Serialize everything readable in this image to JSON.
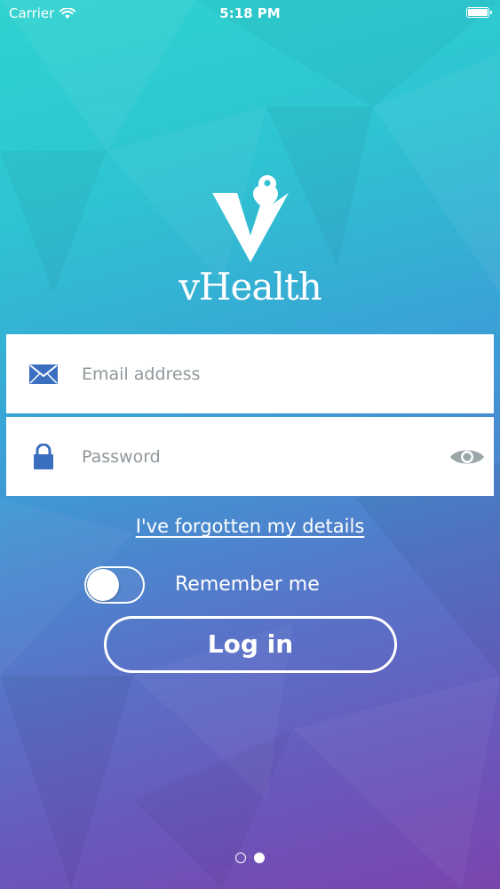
{
  "status_bar": {
    "carrier": "Carrier",
    "time": "5:18 PM",
    "icons": [
      "wifi-icon",
      "battery-icon"
    ]
  },
  "brand": {
    "name": "vHealth",
    "logo_icon": "v-heart-pin-logo"
  },
  "login_form": {
    "email": {
      "placeholder": "Email address",
      "value": "",
      "icon": "envelope-icon"
    },
    "password": {
      "placeholder": "Password",
      "value": "",
      "icon": "lock-icon",
      "toggle_icon": "eye-icon"
    },
    "forgot_link": "I've forgotten my details",
    "remember_me": {
      "label": "Remember me",
      "on": false
    },
    "submit_label": "Log in"
  },
  "pager": {
    "pages": 2,
    "current": 2
  },
  "colors": {
    "gradient_top": "#2fd3cf",
    "gradient_bottom": "#7a45ad",
    "icon_blue": "#3a6fc0",
    "eye_gray": "#9aa6a8"
  }
}
